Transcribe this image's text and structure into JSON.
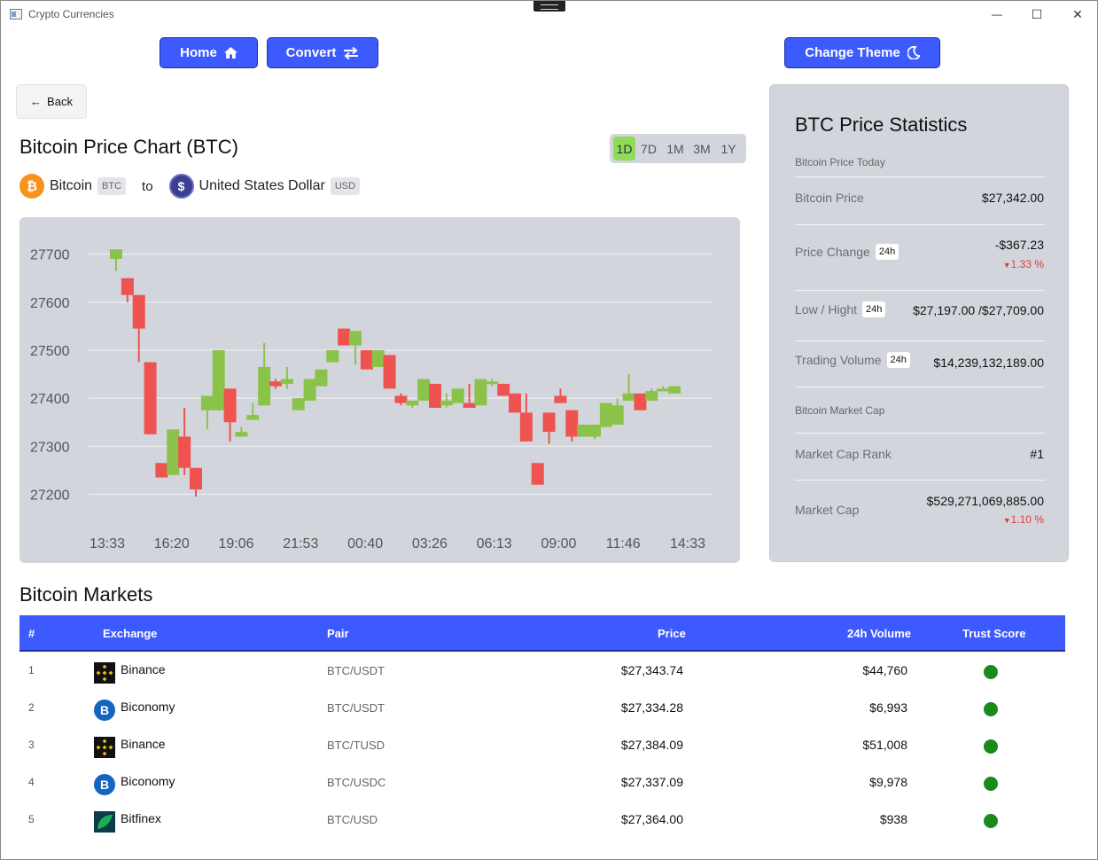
{
  "window": {
    "title": "Crypto Currencies",
    "minimize": "—",
    "maximize": "☐",
    "close": "✕"
  },
  "nav": {
    "home": "Home",
    "convert": "Convert",
    "theme": "Change Theme"
  },
  "back": {
    "arrow": "←",
    "label": "Back"
  },
  "chart_header": {
    "title": "Bitcoin Price Chart (BTC)",
    "ranges": [
      "1D",
      "7D",
      "1M",
      "3M",
      "1Y"
    ],
    "active_range": "1D"
  },
  "pair": {
    "from_name": "Bitcoin",
    "from_code": "BTC",
    "from_symbol": "₿",
    "connector": "to",
    "to_name": "United States Dollar",
    "to_code": "USD",
    "to_symbol": "$"
  },
  "colors": {
    "accent": "#3d5afe",
    "up": "#8bc34a",
    "down": "#ef5350",
    "panel": "#d3d5dc",
    "negative": "#e53935",
    "trust": "#1a8a1a"
  },
  "chart_data": {
    "type": "candlestick",
    "ylim": [
      27140,
      27740
    ],
    "yticks": [
      27700,
      27600,
      27500,
      27400,
      27300,
      27200
    ],
    "xticks": [
      "13:33",
      "16:20",
      "19:06",
      "21:53",
      "00:40",
      "03:26",
      "06:13",
      "09:00",
      "11:46",
      "14:33"
    ],
    "grid": true,
    "candles": [
      {
        "o": 27690,
        "c": 27710,
        "h": 27710,
        "l": 27665
      },
      {
        "o": 27650,
        "c": 27615,
        "h": 27650,
        "l": 27600
      },
      {
        "o": 27615,
        "c": 27545,
        "h": 27615,
        "l": 27475
      },
      {
        "o": 27475,
        "c": 27325,
        "h": 27475,
        "l": 27325
      },
      {
        "o": 27265,
        "c": 27235,
        "h": 27265,
        "l": 27240
      },
      {
        "o": 27240,
        "c": 27335,
        "h": 27335,
        "l": 27240
      },
      {
        "o": 27320,
        "c": 27255,
        "h": 27380,
        "l": 27240
      },
      {
        "o": 27255,
        "c": 27210,
        "h": 27255,
        "l": 27195
      },
      {
        "o": 27375,
        "c": 27405,
        "h": 27405,
        "l": 27335
      },
      {
        "o": 27375,
        "c": 27500,
        "h": 27500,
        "l": 27375
      },
      {
        "o": 27420,
        "c": 27350,
        "h": 27420,
        "l": 27310
      },
      {
        "o": 27320,
        "c": 27330,
        "h": 27340,
        "l": 27320
      },
      {
        "o": 27355,
        "c": 27365,
        "h": 27390,
        "l": 27355
      },
      {
        "o": 27385,
        "c": 27465,
        "h": 27515,
        "l": 27385
      },
      {
        "o": 27435,
        "c": 27425,
        "h": 27440,
        "l": 27420
      },
      {
        "o": 27430,
        "c": 27440,
        "h": 27465,
        "l": 27420
      },
      {
        "o": 27375,
        "c": 27400,
        "h": 27400,
        "l": 27375
      },
      {
        "o": 27395,
        "c": 27440,
        "h": 27440,
        "l": 27395
      },
      {
        "o": 27425,
        "c": 27460,
        "h": 27460,
        "l": 27425
      },
      {
        "o": 27475,
        "c": 27500,
        "h": 27500,
        "l": 27475
      },
      {
        "o": 27545,
        "c": 27510,
        "h": 27545,
        "l": 27510
      },
      {
        "o": 27510,
        "c": 27540,
        "h": 27540,
        "l": 27470
      },
      {
        "o": 27500,
        "c": 27460,
        "h": 27500,
        "l": 27460
      },
      {
        "o": 27465,
        "c": 27500,
        "h": 27500,
        "l": 27465
      },
      {
        "o": 27490,
        "c": 27420,
        "h": 27490,
        "l": 27420
      },
      {
        "o": 27405,
        "c": 27390,
        "h": 27410,
        "l": 27385
      },
      {
        "o": 27385,
        "c": 27395,
        "h": 27395,
        "l": 27380
      },
      {
        "o": 27395,
        "c": 27440,
        "h": 27440,
        "l": 27395
      },
      {
        "o": 27430,
        "c": 27380,
        "h": 27430,
        "l": 27380
      },
      {
        "o": 27385,
        "c": 27395,
        "h": 27410,
        "l": 27380
      },
      {
        "o": 27390,
        "c": 27420,
        "h": 27420,
        "l": 27390
      },
      {
        "o": 27390,
        "c": 27380,
        "h": 27430,
        "l": 27380
      },
      {
        "o": 27385,
        "c": 27440,
        "h": 27440,
        "l": 27385
      },
      {
        "o": 27430,
        "c": 27435,
        "h": 27440,
        "l": 27425
      },
      {
        "o": 27430,
        "c": 27405,
        "h": 27430,
        "l": 27405
      },
      {
        "o": 27410,
        "c": 27370,
        "h": 27410,
        "l": 27370
      },
      {
        "o": 27370,
        "c": 27310,
        "h": 27410,
        "l": 27310
      },
      {
        "o": 27265,
        "c": 27220,
        "h": 27265,
        "l": 27220
      },
      {
        "o": 27370,
        "c": 27330,
        "h": 27370,
        "l": 27305
      },
      {
        "o": 27405,
        "c": 27390,
        "h": 27420,
        "l": 27390
      },
      {
        "o": 27375,
        "c": 27320,
        "h": 27375,
        "l": 27310
      },
      {
        "o": 27320,
        "c": 27345,
        "h": 27345,
        "l": 27320
      },
      {
        "o": 27320,
        "c": 27345,
        "h": 27345,
        "l": 27315
      },
      {
        "o": 27340,
        "c": 27390,
        "h": 27390,
        "l": 27340
      },
      {
        "o": 27345,
        "c": 27385,
        "h": 27400,
        "l": 27345
      },
      {
        "o": 27395,
        "c": 27410,
        "h": 27450,
        "l": 27395
      },
      {
        "o": 27410,
        "c": 27375,
        "h": 27410,
        "l": 27375
      },
      {
        "o": 27395,
        "c": 27415,
        "h": 27420,
        "l": 27395
      },
      {
        "o": 27415,
        "c": 27420,
        "h": 27425,
        "l": 27415
      },
      {
        "o": 27410,
        "c": 27425,
        "h": 27425,
        "l": 27410
      }
    ]
  },
  "stats": {
    "title": "BTC Price Statistics",
    "today_label": "Bitcoin Price Today",
    "price_label": "Bitcoin Price",
    "price_value": "$27,342.00",
    "change_label": "Price Change",
    "change_tag": "24h",
    "change_value": "-$367.23",
    "change_pct": "1.33 %",
    "lowhigh_label": "Low / Hight",
    "lowhigh_tag": "24h",
    "lowhigh_value": "$27,197.00 /$27,709.00",
    "volume_label": "Trading Volume",
    "volume_tag": "24h",
    "volume_value": "$14,239,132,189.00",
    "marketcap_section": "Bitcoin Market Cap",
    "rank_label": "Market Cap Rank",
    "rank_value": "#1",
    "cap_label": "Market Cap",
    "cap_value": "$529,271,069,885.00",
    "cap_pct": "1.10 %"
  },
  "markets": {
    "title": "Bitcoin Markets",
    "headers": {
      "num": "#",
      "exchange": "Exchange",
      "pair": "Pair",
      "price": "Price",
      "volume": "24h Volume",
      "trust": "Trust Score"
    },
    "rows": [
      {
        "num": "1",
        "exchange": "Binance",
        "logo": "binance-logo",
        "pair": "BTC/USDT",
        "price": "$27,343.74",
        "volume": "$44,760"
      },
      {
        "num": "2",
        "exchange": "Biconomy",
        "logo": "biconomy-logo",
        "pair": "BTC/USDT",
        "price": "$27,334.28",
        "volume": "$6,993"
      },
      {
        "num": "3",
        "exchange": "Binance",
        "logo": "binance-logo",
        "pair": "BTC/TUSD",
        "price": "$27,384.09",
        "volume": "$51,008"
      },
      {
        "num": "4",
        "exchange": "Biconomy",
        "logo": "biconomy-logo",
        "pair": "BTC/USDC",
        "price": "$27,337.09",
        "volume": "$9,978"
      },
      {
        "num": "5",
        "exchange": "Bitfinex",
        "logo": "bitfinex-logo",
        "pair": "BTC/USD",
        "price": "$27,364.00",
        "volume": "$938"
      }
    ]
  }
}
